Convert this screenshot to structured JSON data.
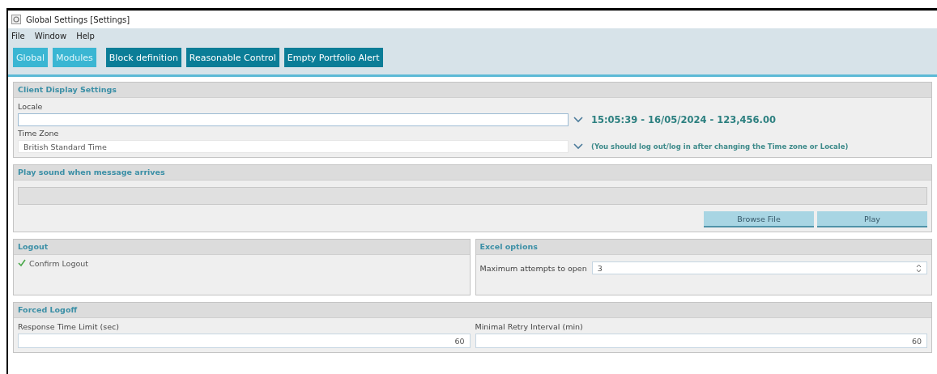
{
  "window": {
    "title": "Global Settings [Settings]"
  },
  "menu": [
    {
      "label": "File"
    },
    {
      "label": "Window"
    },
    {
      "label": "Help"
    }
  ],
  "tabs": [
    {
      "label": "Global",
      "selected": true
    },
    {
      "label": "Modules",
      "selected": true
    },
    {
      "label": "Block definition",
      "selected": false
    },
    {
      "label": "Reasonable Control",
      "selected": false
    },
    {
      "label": "Empty Portfolio Alert",
      "selected": false
    }
  ],
  "client_display": {
    "title": "Client Display Settings",
    "locale": {
      "label": "Locale"
    },
    "locale_preview": "15:05:39 - 16/05/2024 - 123,456.00",
    "time_zone": {
      "label": "Time Zone",
      "value": "British Standard Time"
    },
    "note": "(You should log out/log in after changing the Time zone or Locale)"
  },
  "sound": {
    "title": "Play sound when message arrives",
    "buttons": [
      "Browse File",
      "Play"
    ]
  },
  "logout": {
    "title": "Logout",
    "confirm": {
      "label": "Confirm Logout",
      "checked": true
    }
  },
  "excel": {
    "title": "Excel options",
    "max_attempts": {
      "label": "Maximum attempts to open",
      "value": "3"
    }
  },
  "forced_logoff": {
    "title": "Forced Logoff",
    "fields": [
      {
        "label": "Response Time Limit (sec)",
        "value": "60"
      },
      {
        "label": "Minimal Retry Interval (min)",
        "value": "60"
      }
    ]
  }
}
